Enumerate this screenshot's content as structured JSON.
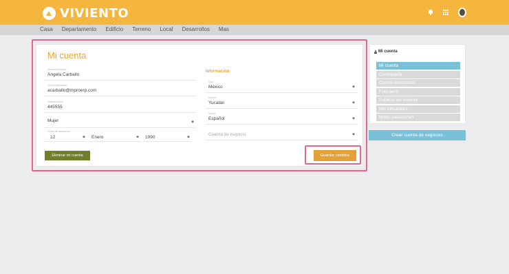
{
  "brand": {
    "name": "VIVIENTO"
  },
  "header": {
    "icons": [
      "bell-icon",
      "apps-grid-icon",
      "user-avatar"
    ]
  },
  "nav": {
    "items": [
      "Casa",
      "Departamento",
      "Edificio",
      "Terreno",
      "Local",
      "Desarrollos",
      "Mas"
    ]
  },
  "account": {
    "title": "Mi cuenta",
    "fields": {
      "name": {
        "label": "Nombre completo",
        "value": "Angela Carballo"
      },
      "email": {
        "label": "Correo electrónico",
        "value": "acarballo@mproerp.com"
      },
      "phone": {
        "label": "Teléfono móvil",
        "value": "445555"
      },
      "gender": {
        "value": "Mujer"
      },
      "birth": {
        "label": "Fecha de nacimiento",
        "day": "12",
        "month": "Enero",
        "year": "1990"
      }
    },
    "info": {
      "label": "Información",
      "country": {
        "label": "País",
        "value": "México"
      },
      "state": {
        "label": "Estado",
        "value": "Yucatán"
      },
      "language": {
        "label": "Idioma",
        "value": "Español"
      },
      "business_account": {
        "placeholder": "Cuenta de negocio"
      }
    },
    "buttons": {
      "delete": "Eliminar mi cuenta",
      "save": "Guardar cambios"
    }
  },
  "sidebar": {
    "title": "Mi cuenta",
    "items": [
      {
        "label": "Mi cuenta",
        "active": true
      },
      {
        "label": "Contraseña",
        "active": false
      },
      {
        "label": "Correo electronico",
        "active": false
      },
      {
        "label": "Foto perfil",
        "active": false
      },
      {
        "label": "Publicar en viviento",
        "active": false
      },
      {
        "label": "Mis inmuebles",
        "active": false
      },
      {
        "label": "Modo vacaciones",
        "active": false
      }
    ],
    "create_business": "Crear cuenta de negocios"
  },
  "colors": {
    "brand": "#f5b63d",
    "accent_text": "#e7a53a",
    "delete_button": "#6f7f2a",
    "save_button": "#e3a13a",
    "sidebar_active": "#79c1d7",
    "highlight_outline": "#e9668b"
  }
}
